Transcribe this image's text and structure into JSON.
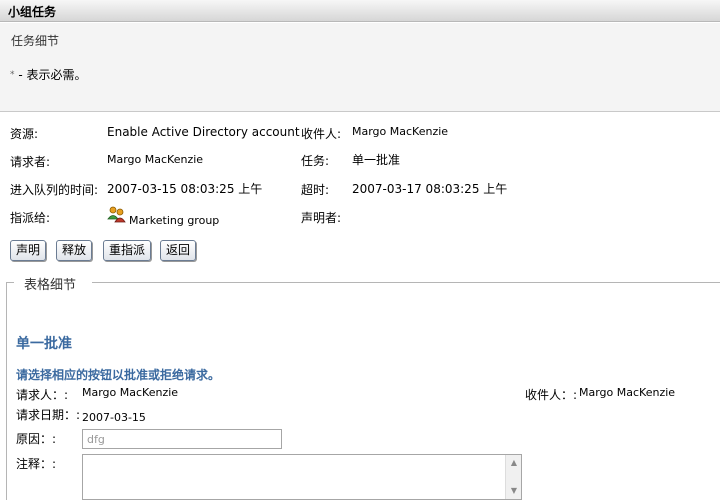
{
  "window": {
    "title": "小组任务"
  },
  "header": {
    "subtitle": "任务细节",
    "required_star": "*",
    "required_note": " - 表示必需。"
  },
  "details": {
    "resource_label": "资源:",
    "resource_value": "Enable Active Directory account",
    "recipient_label": "收件人:",
    "recipient_value": "Margo MacKenzie",
    "requester_label": "请求者:",
    "requester_value": "Margo MacKenzie",
    "task_label": "任务:",
    "task_value": "单一批准",
    "queued_label": "进入队列的时间:",
    "queued_value": "2007-03-15 08:03:25 上午",
    "timeout_label": "超时:",
    "timeout_value": "2007-03-17 08:03:25 上午",
    "assigned_label": "指派给:",
    "assigned_value": "Marketing group",
    "claimant_label": "声明者:"
  },
  "buttons": {
    "claim": "声明",
    "release": "释放",
    "reassign": "重指派",
    "back": "返回"
  },
  "form": {
    "legend": "表格细节",
    "title": "单一批准",
    "instruction": "请选择相应的按钮以批准或拒绝请求。",
    "requester_label": "请求人：:",
    "requester_value": "Margo MacKenzie",
    "recipient_label": "收件人：:",
    "recipient_value": "Margo MacKenzie",
    "request_date_label": "请求日期：:",
    "request_date_value": "2007-03-15",
    "reason_label": "原因：:",
    "reason_value": "dfg",
    "comment_label": "注释：:"
  },
  "icons": {
    "group": "group-users-icon",
    "scroll_up": "scroll-up-icon",
    "scroll_down": "scroll-down-icon"
  }
}
